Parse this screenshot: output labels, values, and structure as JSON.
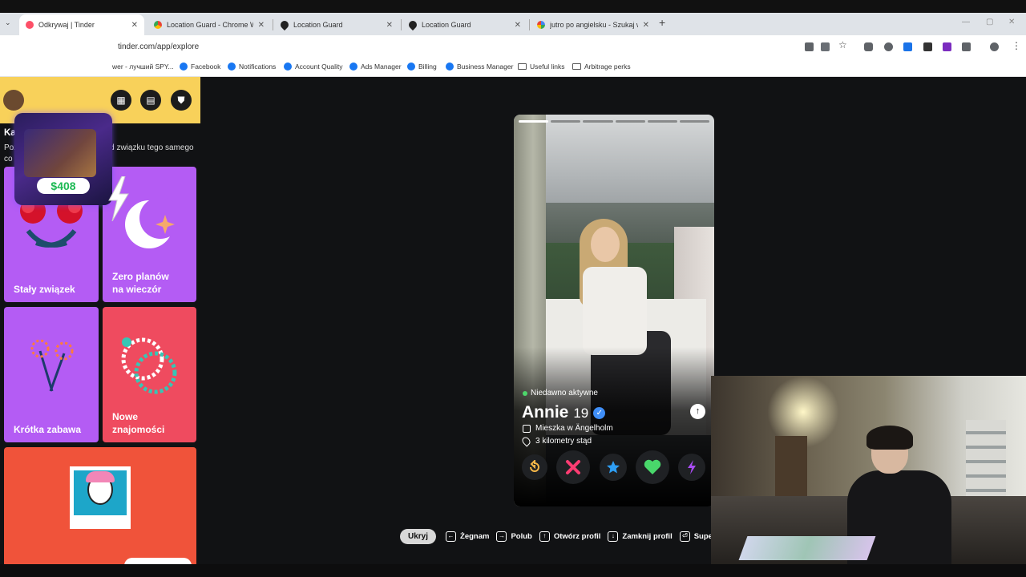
{
  "browser": {
    "tabs": [
      {
        "label": "Odkrywaj | Tinder",
        "active": true
      },
      {
        "label": "Location Guard - Chrome Web",
        "active": false
      },
      {
        "label": "Location Guard",
        "active": false
      },
      {
        "label": "Location Guard",
        "active": false
      },
      {
        "label": "jutro po angielsku - Szukaj w G",
        "active": false
      }
    ],
    "url": "tinder.com/app/explore",
    "bookmarks": [
      "wer - лучший SPY...",
      "Facebook",
      "Notifications",
      "Account Quality",
      "Ads Manager",
      "Billing",
      "Business Manager",
      "Useful links",
      "Arbitrage perks"
    ]
  },
  "overlay": {
    "price": "$408"
  },
  "explore": {
    "section_title": "Kawa na ławę",
    "section_desc": "Poznawaj osoby, które chcą od związku tego samego co Ty",
    "cards": [
      {
        "label": "Stały związek",
        "color": "#b45cf4"
      },
      {
        "label": "Zero planów\nna wieczór",
        "color": "#b45cf4"
      },
      {
        "label": "Krótka zabawa",
        "color": "#b45cf4"
      },
      {
        "label": "Nowe\nznajomości",
        "color": "#ef4b5f"
      }
    ],
    "bottom_card_color": "#f0533a"
  },
  "profile": {
    "status": "Niedawno aktywne",
    "name": "Annie",
    "age": "19",
    "lives_in": "Mieszka w Ängelholm",
    "distance": "3 kilometry stąd"
  },
  "actions": [
    "rewind-icon",
    "nope-icon",
    "super-like-icon",
    "like-icon",
    "boost-icon"
  ],
  "hotkeys": {
    "hide": "Ukryj",
    "items": [
      {
        "label": "Żegnam",
        "key": "←"
      },
      {
        "label": "Polub",
        "key": "→"
      },
      {
        "label": "Otwórz profil",
        "key": "↑"
      },
      {
        "label": "Zamknij profil",
        "key": "↓"
      },
      {
        "label": "Super l",
        "key": "⏎"
      }
    ]
  }
}
